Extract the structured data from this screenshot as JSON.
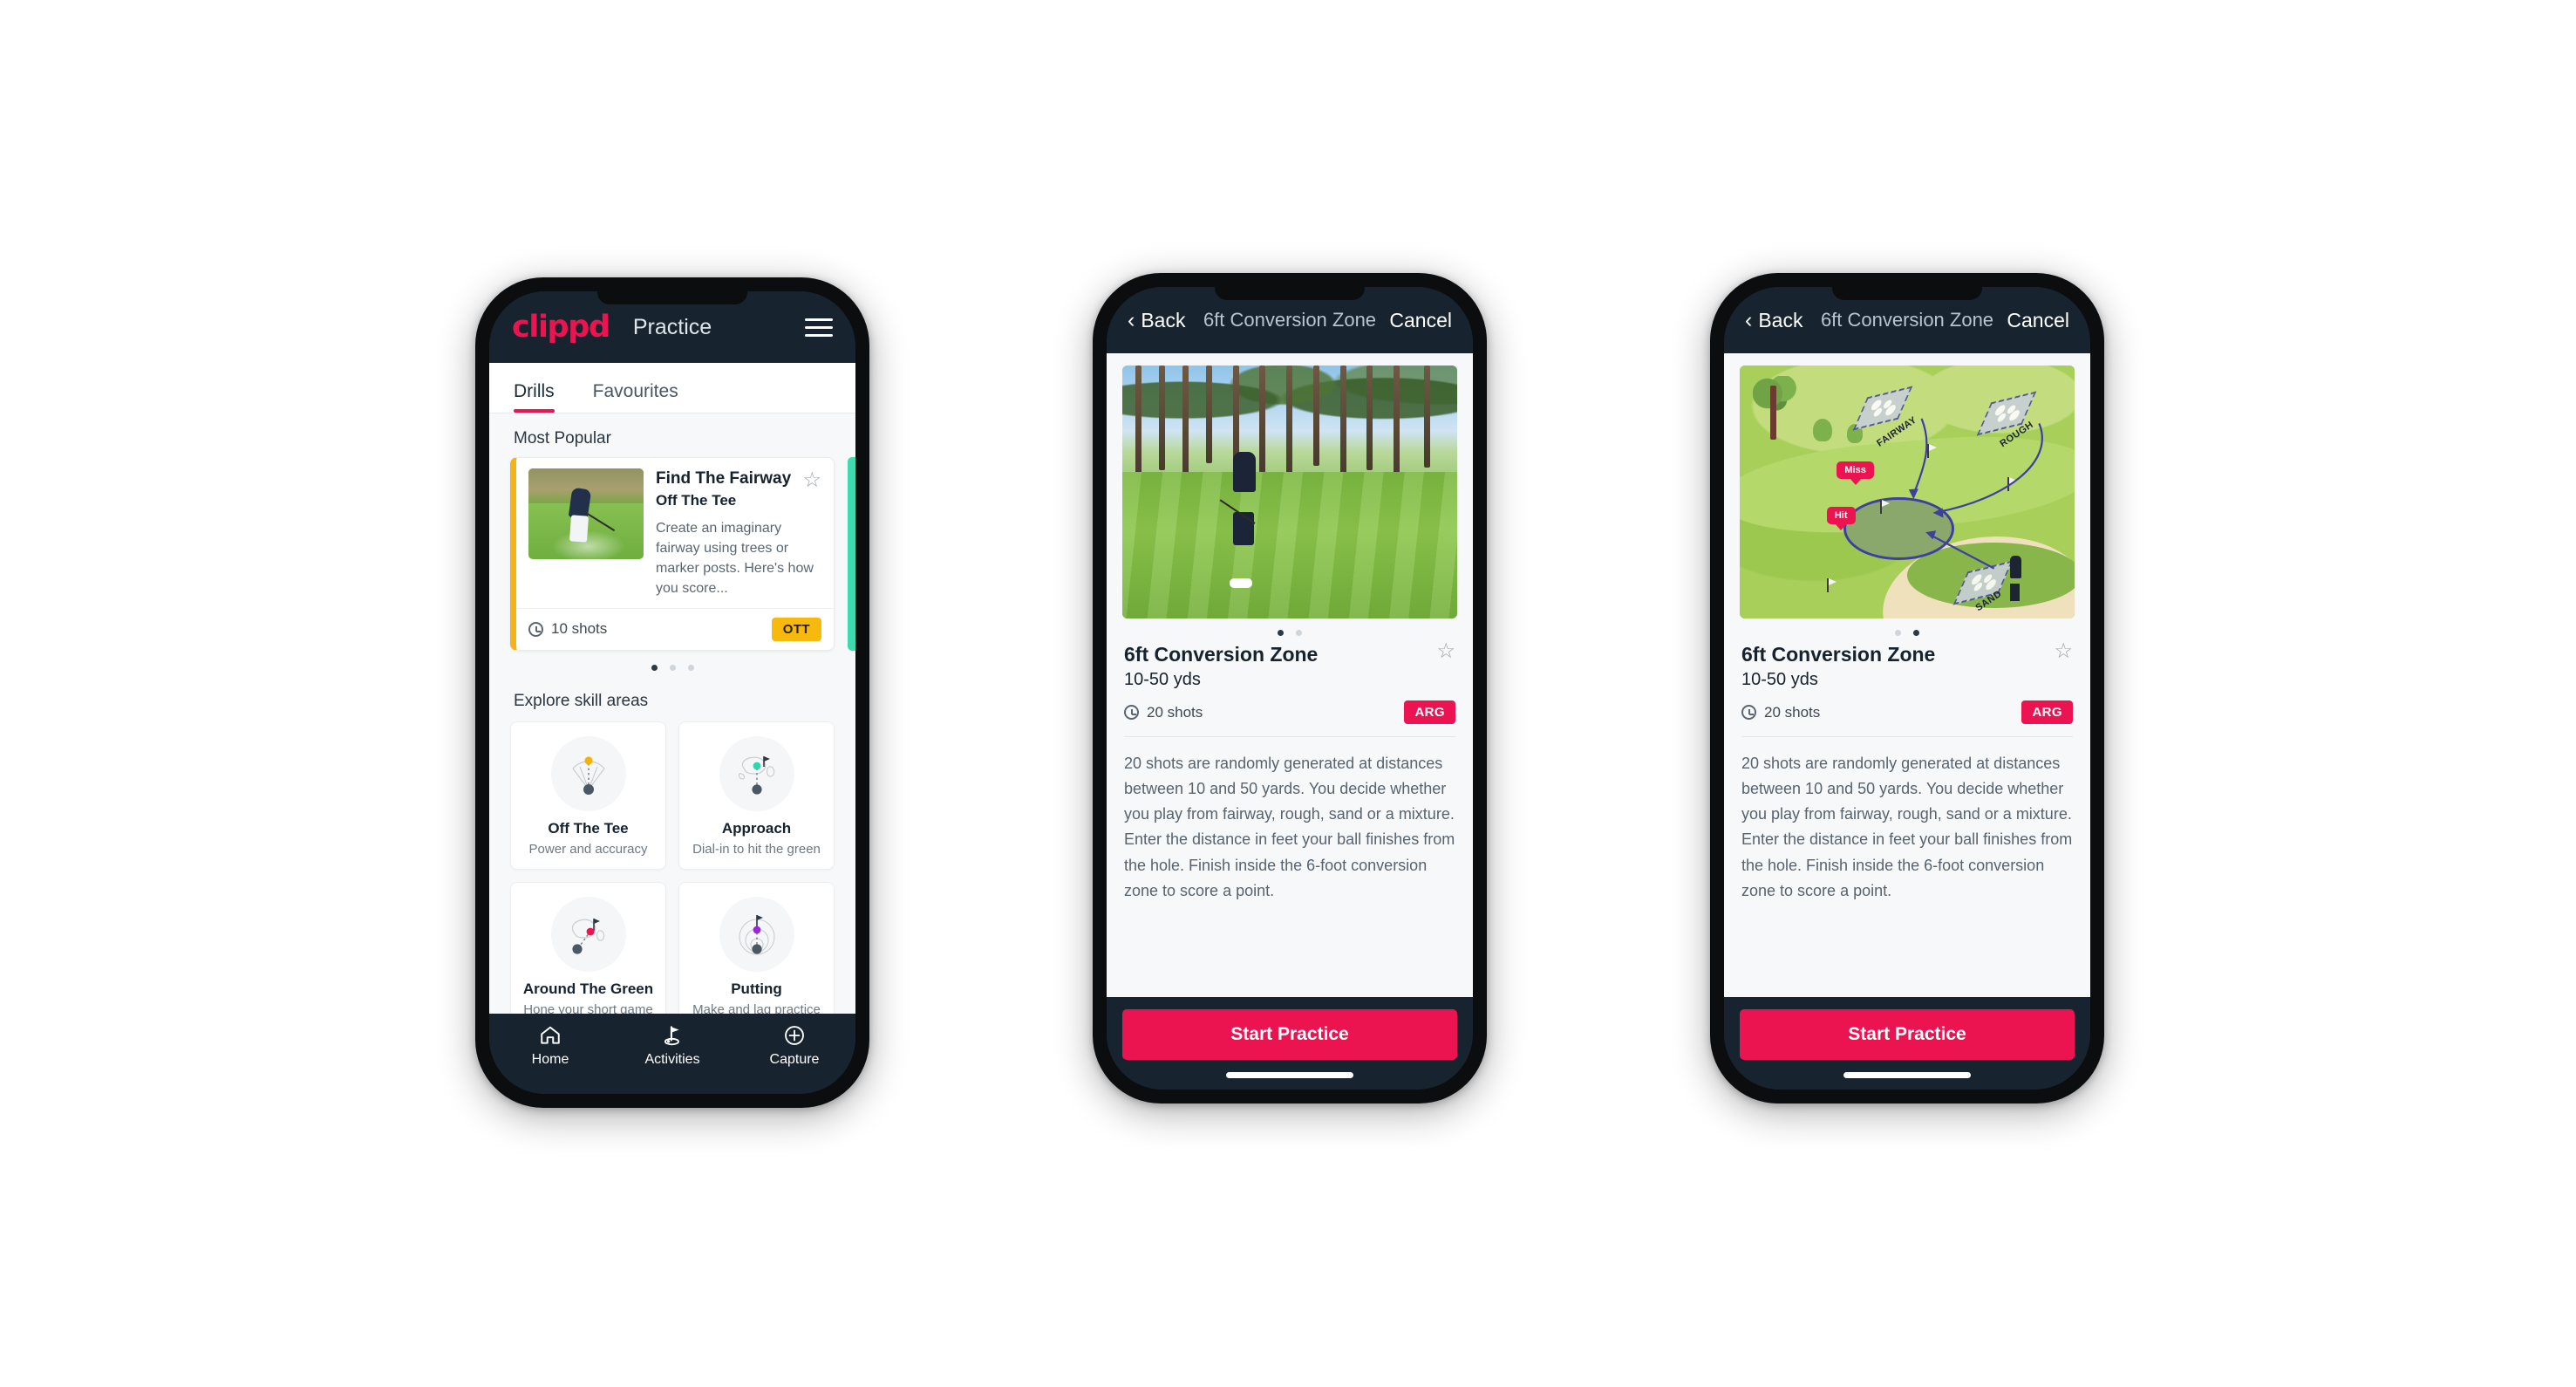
{
  "phone1": {
    "appbar": {
      "brand": "clippd",
      "title": "Practice",
      "menu_icon": "hamburger-icon"
    },
    "tabs": [
      {
        "label": "Drills",
        "active": true
      },
      {
        "label": "Favourites",
        "active": false
      }
    ],
    "most_popular": {
      "section_title": "Most Popular",
      "card": {
        "title": "Find The Fairway",
        "subtitle": "Off The Tee",
        "description": "Create an imaginary fairway using trees or marker posts. Here's how you score...",
        "shots": "10 shots",
        "tag": "OTT",
        "tag_color": "#f7b90d",
        "accent_color": "#f6b318",
        "star_icon": "star-outline-icon"
      },
      "dots": [
        true,
        false,
        false
      ]
    },
    "skill_areas": {
      "section_title": "Explore skill areas",
      "items": [
        {
          "name": "Off The Tee",
          "desc": "Power and accuracy",
          "icon": "off-the-tee-icon",
          "dot_color": "#f5b301"
        },
        {
          "name": "Approach",
          "desc": "Dial-in to hit the green",
          "icon": "approach-icon",
          "dot_color": "#2fd6ac"
        },
        {
          "name": "Around The Green",
          "desc": "Hone your short game",
          "icon": "around-the-green-icon",
          "dot_color": "#ec1351"
        },
        {
          "name": "Putting",
          "desc": "Make and lag practice",
          "icon": "putting-icon",
          "dot_color": "#9b27d6"
        }
      ]
    },
    "bottom_nav": [
      {
        "label": "Home",
        "icon": "home-icon",
        "active": false
      },
      {
        "label": "Activities",
        "icon": "golf-flag-icon",
        "active": true
      },
      {
        "label": "Capture",
        "icon": "plus-circle-icon",
        "active": false
      }
    ]
  },
  "phone2": {
    "navbar": {
      "back": "Back",
      "title": "6ft Conversion Zone",
      "cancel": "Cancel",
      "back_icon": "chevron-left-icon"
    },
    "media": {
      "kind": "photo",
      "alt": "golfer-chipping-photo"
    },
    "dots": [
      true,
      false
    ],
    "detail": {
      "title": "6ft Conversion Zone",
      "yards": "10-50 yds",
      "shots": "20 shots",
      "tag": "ARG",
      "tag_color": "#ec1351",
      "star_icon": "star-outline-icon",
      "description": "20 shots are randomly generated at distances between 10 and 50 yards. You decide whether you play from fairway, rough, sand or a mixture. Enter the distance in feet your ball finishes from the hole. Finish inside the 6-foot conversion zone to score a point."
    },
    "cta": {
      "label": "Start Practice",
      "color": "#ec1351"
    }
  },
  "phone3": {
    "navbar": {
      "back": "Back",
      "title": "6ft Conversion Zone",
      "cancel": "Cancel",
      "back_icon": "chevron-left-icon"
    },
    "media": {
      "kind": "illustration",
      "alt": "golf-course-diagram",
      "zone_labels": [
        "FAIRWAY",
        "ROUGH",
        "SAND"
      ],
      "callouts": [
        "Miss",
        "Hit"
      ]
    },
    "dots": [
      false,
      true
    ],
    "detail": {
      "title": "6ft Conversion Zone",
      "yards": "10-50 yds",
      "shots": "20 shots",
      "tag": "ARG",
      "tag_color": "#ec1351",
      "star_icon": "star-outline-icon",
      "description": "20 shots are randomly generated at distances between 10 and 50 yards. You decide whether you play from fairway, rough, sand or a mixture. Enter the distance in feet your ball finishes from the hole. Finish inside the 6-foot conversion zone to score a point."
    },
    "cta": {
      "label": "Start Practice",
      "color": "#ec1351"
    }
  }
}
